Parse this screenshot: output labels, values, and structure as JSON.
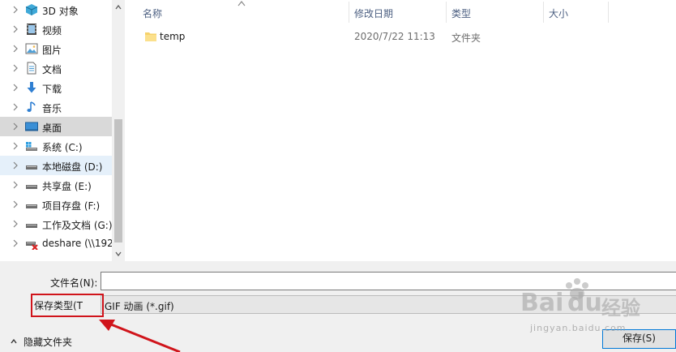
{
  "nav": {
    "items": [
      {
        "label": "3D 对象",
        "icon": "3d-objects-icon"
      },
      {
        "label": "视频",
        "icon": "videos-icon"
      },
      {
        "label": "图片",
        "icon": "pictures-icon"
      },
      {
        "label": "文档",
        "icon": "documents-icon"
      },
      {
        "label": "下载",
        "icon": "downloads-icon"
      },
      {
        "label": "音乐",
        "icon": "music-icon"
      },
      {
        "label": "桌面",
        "icon": "desktop-icon",
        "state": "selected"
      },
      {
        "label": "系统 (C:)",
        "icon": "system-drive-icon"
      },
      {
        "label": "本地磁盘 (D:)",
        "icon": "drive-icon",
        "state": "highlighted"
      },
      {
        "label": "共享盘 (E:)",
        "icon": "drive-icon"
      },
      {
        "label": "项目存盘 (F:)",
        "icon": "drive-icon"
      },
      {
        "label": "工作及文档 (G:)",
        "icon": "drive-icon"
      },
      {
        "label": "deshare (\\\\192",
        "icon": "network-drive-disconnected-icon"
      }
    ]
  },
  "columns": {
    "name": "名称",
    "modified": "修改日期",
    "type": "类型",
    "size": "大小"
  },
  "files": [
    {
      "name": "temp",
      "modified": "2020/7/22 11:13",
      "type": "文件夹",
      "icon": "folder-icon"
    }
  ],
  "form": {
    "filename_label": "文件名(N):",
    "filename_value": "",
    "filetype_label": "保存类型(T",
    "filetype_value": "GIF 动画 (*.gif)",
    "hide_folders": "隐藏文件夹",
    "save_button": "保存(S)"
  },
  "watermark": {
    "brand": "Bai",
    "brand2": "du",
    "cn": "经验",
    "url": "jingyan.baidu.com"
  },
  "colors": {
    "selected_bg": "#d9d9d9",
    "highlight_bg": "#e5f0fa",
    "header_text": "#4d6082",
    "annotation_red": "#d0141b",
    "accent_blue": "#0078d7"
  }
}
